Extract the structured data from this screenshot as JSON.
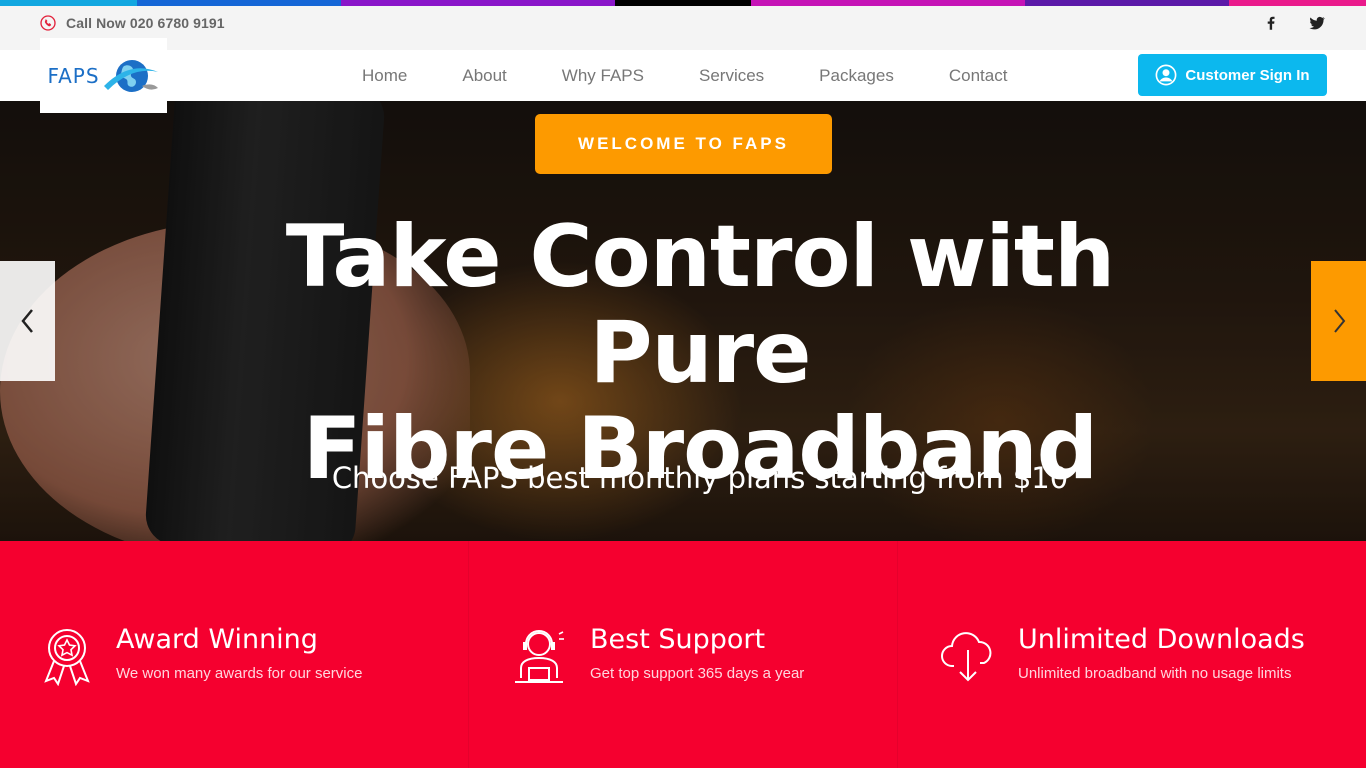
{
  "colors": {
    "strip": [
      "#12a7e0",
      "#1566d6",
      "#8a16c9",
      "#000000",
      "#c513b6",
      "#5b19a8",
      "#ea1a8c"
    ],
    "accent_orange": "#fd9a00",
    "accent_blue": "#0cb8ee",
    "feature_red": "#f5002f"
  },
  "topbar": {
    "phone_icon": "phone-icon",
    "phone": "Call Now 020 6780 9191",
    "social": [
      "facebook-icon",
      "twitter-icon"
    ]
  },
  "logo": {
    "text": "FAPS"
  },
  "nav": {
    "items": [
      "Home",
      "About",
      "Why FAPS",
      "Services",
      "Packages",
      "Contact"
    ],
    "signin": "Customer Sign In"
  },
  "hero": {
    "welcome": "WELCOME TO FAPS",
    "title_line1": "Take Control with Pure",
    "title_line2": "Fibre Broadband",
    "subtitle": "Choose FAPS best monthly plans starting from $10"
  },
  "features": [
    {
      "icon": "award-ribbon-icon",
      "title": "Award Winning",
      "desc": "We won many awards for our service"
    },
    {
      "icon": "support-agent-icon",
      "title": "Best Support",
      "desc": "Get top support 365 days a year"
    },
    {
      "icon": "cloud-download-icon",
      "title": "Unlimited Downloads",
      "desc": "Unlimited broadband with no usage limits"
    }
  ]
}
